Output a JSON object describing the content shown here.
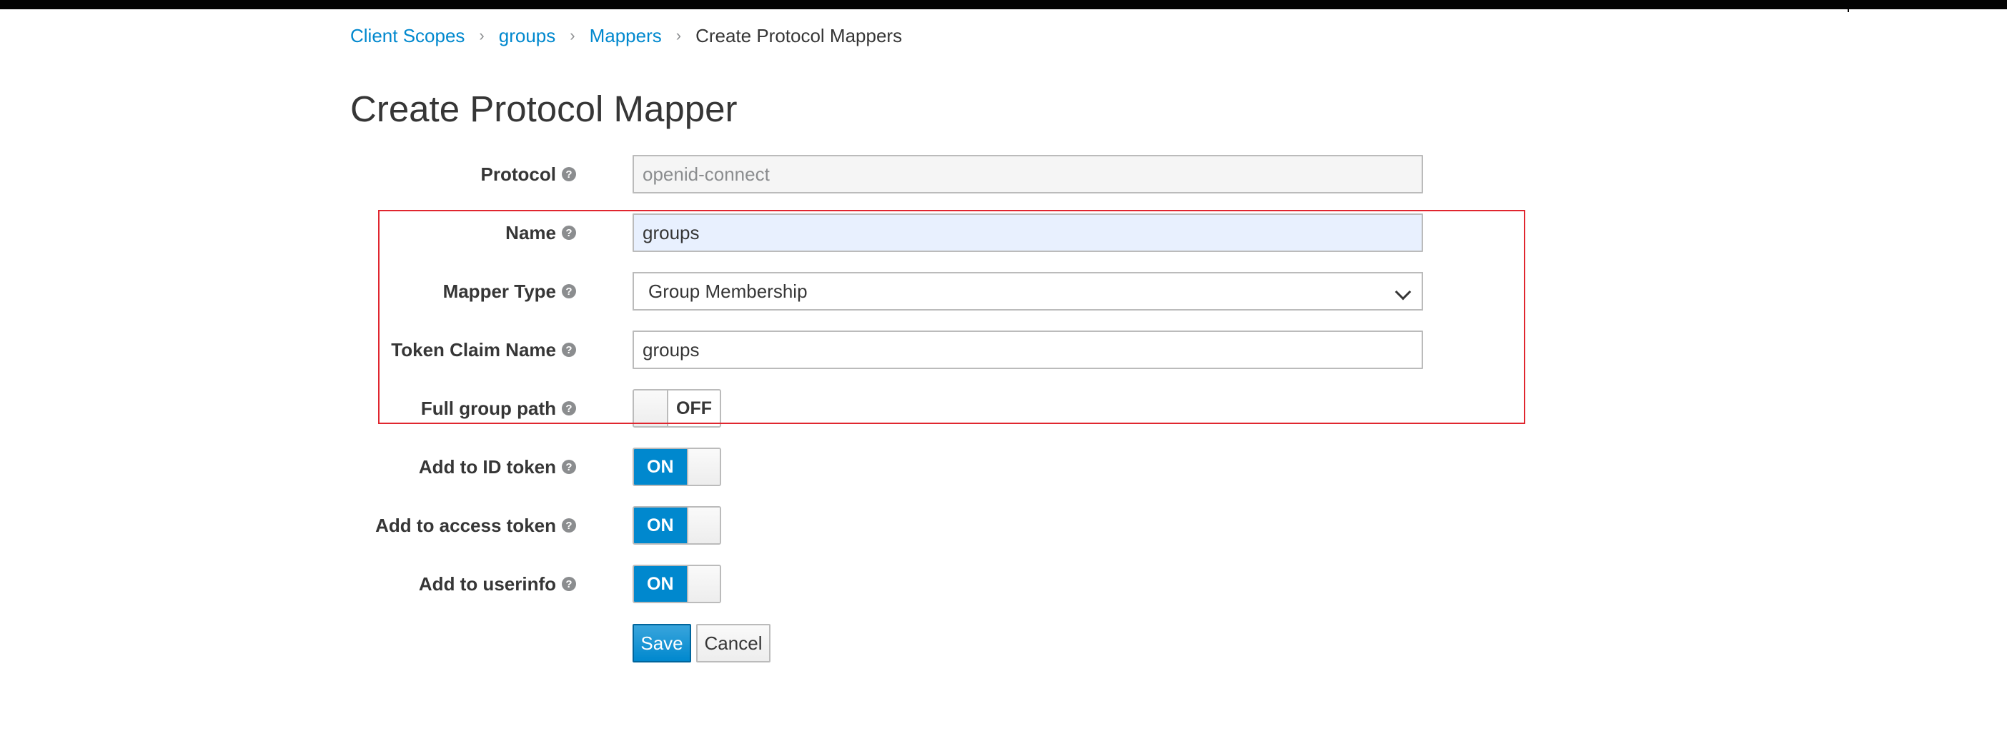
{
  "breadcrumb": {
    "items": [
      {
        "label": "Client Scopes"
      },
      {
        "label": "groups"
      },
      {
        "label": "Mappers"
      }
    ],
    "current": "Create Protocol Mappers",
    "separator": "›"
  },
  "page": {
    "title": "Create Protocol Mapper"
  },
  "form": {
    "help_glyph": "?",
    "protocol": {
      "label": "Protocol",
      "value": "openid-connect"
    },
    "name": {
      "label": "Name",
      "value": "groups"
    },
    "mapper_type": {
      "label": "Mapper Type",
      "value": "Group Membership"
    },
    "token_claim_name": {
      "label": "Token Claim Name",
      "value": "groups"
    },
    "full_group_path": {
      "label": "Full group path",
      "state": "OFF"
    },
    "add_to_id_token": {
      "label": "Add to ID token",
      "state": "ON"
    },
    "add_to_access_token": {
      "label": "Add to access token",
      "state": "ON"
    },
    "add_to_userinfo": {
      "label": "Add to userinfo",
      "state": "ON"
    }
  },
  "actions": {
    "save_label": "Save",
    "cancel_label": "Cancel"
  },
  "colors": {
    "accent": "#0088ce",
    "highlight": "#e0262f",
    "topbar": "#030303"
  },
  "icons": {
    "help": "question-circle-icon",
    "dropdown": "chevron-down-icon",
    "separator": "chevron-right-icon"
  }
}
